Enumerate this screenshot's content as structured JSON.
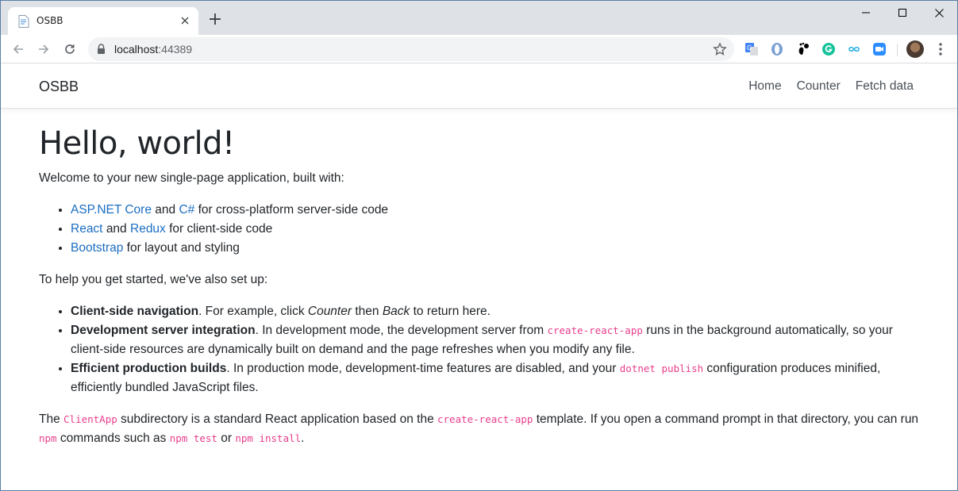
{
  "browser": {
    "tab_title": "OSBB",
    "url_host": "localhost",
    "url_port": ":44389",
    "new_tab": "+",
    "icons": [
      "back-icon",
      "forward-icon",
      "reload-icon",
      "lock-icon",
      "star-icon",
      "translate-extension-icon",
      "opera-extension-icon",
      "gnome-extension-icon",
      "grammarly-extension-icon",
      "infinity-extension-icon",
      "zoom-extension-icon",
      "profile-avatar",
      "menu-icon"
    ]
  },
  "navbar": {
    "brand": "OSBB",
    "links": [
      "Home",
      "Counter",
      "Fetch data"
    ]
  },
  "content": {
    "heading": "Hello, world!",
    "intro": "Welcome to your new single-page application, built with:",
    "stack": [
      {
        "a": "ASP.NET Core",
        "mid": "and",
        "b": "C#",
        "rest": "for cross-platform server-side code"
      },
      {
        "a": "React",
        "mid": "and",
        "b": "Redux",
        "rest": "for client-side code"
      },
      {
        "a": "Bootstrap",
        "rest": "for layout and styling"
      }
    ],
    "setup_intro": "To help you get started, we've also set up:",
    "features": [
      {
        "title": "Client-side navigation",
        "t1": ". For example, click ",
        "em1": "Counter",
        "t2": " then ",
        "em2": "Back",
        "t3": " to return here."
      },
      {
        "title": "Development server integration",
        "t1": ". In development mode, the development server from ",
        "code": "create-react-app",
        "t2": " runs in the background automatically, so your client-side resources are dynamically built on demand and the page refreshes when you modify any file."
      },
      {
        "title": "Efficient production builds",
        "t1": ". In production mode, development-time features are disabled, and your ",
        "code": "dotnet publish",
        "t2": " configuration produces minified, efficiently bundled JavaScript files."
      }
    ],
    "footer": {
      "t1": "The ",
      "code1": "ClientApp",
      "t2": " subdirectory is a standard React application based on the ",
      "code2": "create-react-app",
      "t3": " template. If you open a command prompt in that directory, you can run ",
      "code3": "npm",
      "t4": " commands such as ",
      "code4": "npm test",
      "t5": " or ",
      "code5": "npm install",
      "t6": "."
    }
  },
  "colors": {
    "link": "#1b6ec2",
    "code": "#e83e8c",
    "tabstrip": "#dee1e6"
  }
}
